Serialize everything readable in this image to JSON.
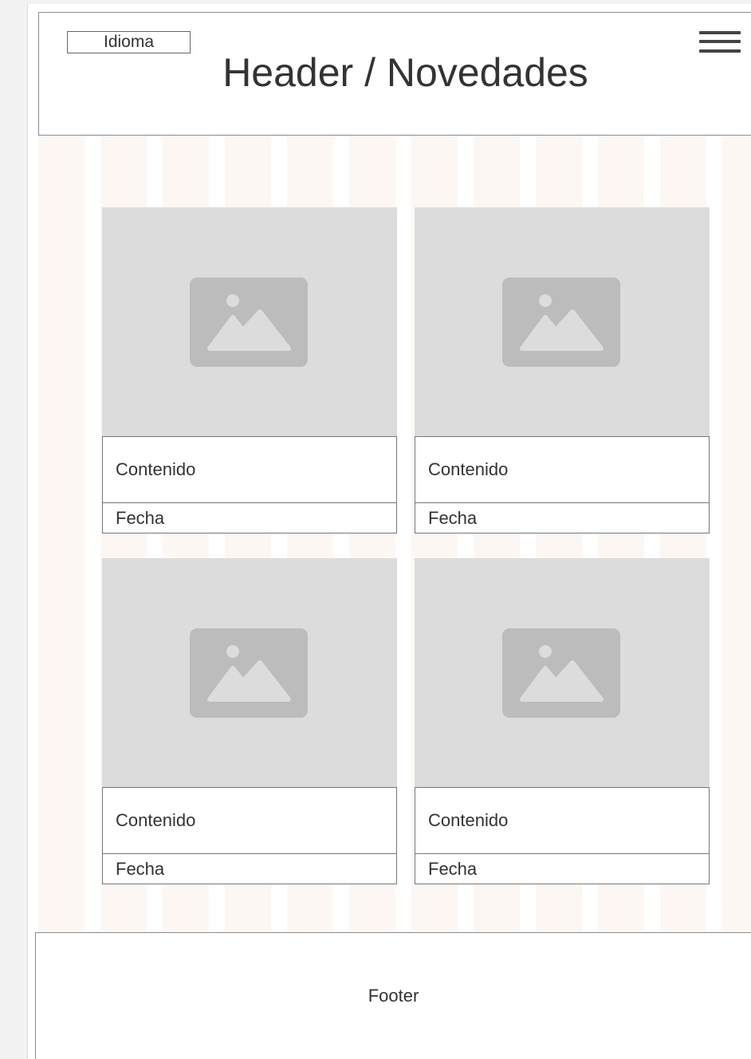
{
  "header": {
    "language_label": "Idioma",
    "title": "Header / Novedades",
    "menu_icon": "hamburger-menu-icon"
  },
  "news": [
    {
      "content": "Contenido",
      "date": "Fecha",
      "image_icon": "image-placeholder-icon"
    },
    {
      "content": "Contenido",
      "date": "Fecha",
      "image_icon": "image-placeholder-icon"
    },
    {
      "content": "Contenido",
      "date": "Fecha",
      "image_icon": "image-placeholder-icon"
    },
    {
      "content": "Contenido",
      "date": "Fecha",
      "image_icon": "image-placeholder-icon"
    }
  ],
  "footer": {
    "label": "Footer"
  },
  "colors": {
    "placeholder": "#dcdcdc",
    "placeholder_icon": "#bcbcbc",
    "column_guide": "#fdf7f4"
  }
}
